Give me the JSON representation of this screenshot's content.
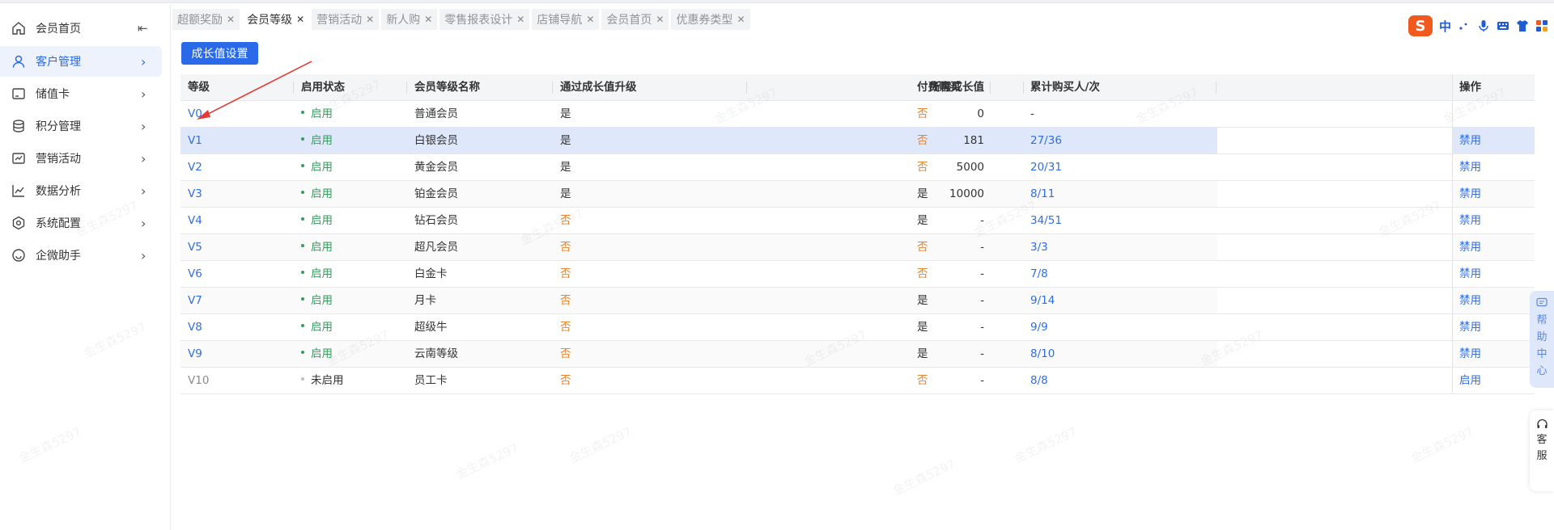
{
  "sidebar": {
    "collapse_icon": "collapse-left-icon",
    "items": [
      {
        "label": "会员首页",
        "icon": "home-icon",
        "has_chevron": false,
        "active": false
      },
      {
        "label": "客户管理",
        "icon": "user-icon",
        "has_chevron": true,
        "active": true
      },
      {
        "label": "储值卡",
        "icon": "card-icon",
        "has_chevron": true,
        "active": false
      },
      {
        "label": "积分管理",
        "icon": "database-icon",
        "has_chevron": true,
        "active": false
      },
      {
        "label": "营销活动",
        "icon": "chart-card-icon",
        "has_chevron": true,
        "active": false
      },
      {
        "label": "数据分析",
        "icon": "line-chart-icon",
        "has_chevron": true,
        "active": false
      },
      {
        "label": "系统配置",
        "icon": "settings-hex-icon",
        "has_chevron": true,
        "active": false
      },
      {
        "label": "企微助手",
        "icon": "chat-bubble-icon",
        "has_chevron": true,
        "active": false
      }
    ]
  },
  "tabs": [
    {
      "label": "超额奖励",
      "active": false
    },
    {
      "label": "会员等级",
      "active": true
    },
    {
      "label": "营销活动",
      "active": false
    },
    {
      "label": "新人购",
      "active": false
    },
    {
      "label": "零售报表设计",
      "active": false
    },
    {
      "label": "店铺导航",
      "active": false
    },
    {
      "label": "会员首页",
      "active": false
    },
    {
      "label": "优惠券类型",
      "active": false
    }
  ],
  "toolbar": {
    "growth_settings_label": "成长值设置"
  },
  "table": {
    "headers": {
      "level": "等级",
      "status": "启用状态",
      "name": "会员等级名称",
      "upgrade": "通过成长值升级",
      "required": "所需成长值",
      "paid": "付费购买",
      "buyers": "累计购买人/次",
      "ops": "操作"
    },
    "rows": [
      {
        "level": "V0",
        "status": "启用",
        "enabled": true,
        "name": "普通会员",
        "upgrade": "是",
        "required": "0",
        "paid": "否",
        "buyers": "-",
        "op": ""
      },
      {
        "level": "V1",
        "status": "启用",
        "enabled": true,
        "name": "白银会员",
        "upgrade": "是",
        "required": "181",
        "paid": "否",
        "buyers": "27/36",
        "op": "禁用"
      },
      {
        "level": "V2",
        "status": "启用",
        "enabled": true,
        "name": "黄金会员",
        "upgrade": "是",
        "required": "5000",
        "paid": "否",
        "buyers": "20/31",
        "op": "禁用"
      },
      {
        "level": "V3",
        "status": "启用",
        "enabled": true,
        "name": "铂金会员",
        "upgrade": "是",
        "required": "10000",
        "paid": "是",
        "buyers": "8/11",
        "op": "禁用"
      },
      {
        "level": "V4",
        "status": "启用",
        "enabled": true,
        "name": "钻石会员",
        "upgrade": "否",
        "required": "-",
        "paid": "是",
        "buyers": "34/51",
        "op": "禁用"
      },
      {
        "level": "V5",
        "status": "启用",
        "enabled": true,
        "name": "超凡会员",
        "upgrade": "否",
        "required": "-",
        "paid": "否",
        "buyers": "3/3",
        "op": "禁用"
      },
      {
        "level": "V6",
        "status": "启用",
        "enabled": true,
        "name": "白金卡",
        "upgrade": "否",
        "required": "-",
        "paid": "否",
        "buyers": "7/8",
        "op": "禁用"
      },
      {
        "level": "V7",
        "status": "启用",
        "enabled": true,
        "name": "月卡",
        "upgrade": "否",
        "required": "-",
        "paid": "是",
        "buyers": "9/14",
        "op": "禁用"
      },
      {
        "level": "V8",
        "status": "启用",
        "enabled": true,
        "name": "超级牛",
        "upgrade": "否",
        "required": "-",
        "paid": "是",
        "buyers": "9/9",
        "op": "禁用"
      },
      {
        "level": "V9",
        "status": "启用",
        "enabled": true,
        "name": "云南等级",
        "upgrade": "否",
        "required": "-",
        "paid": "是",
        "buyers": "8/10",
        "op": "禁用"
      },
      {
        "level": "V10",
        "status": "未启用",
        "enabled": false,
        "name": "员工卡",
        "upgrade": "否",
        "required": "-",
        "paid": "否",
        "buyers": "8/8",
        "op": "启用"
      }
    ]
  },
  "ime_toolbar": {
    "logo": "S",
    "mode": "中",
    "icons": [
      "punctuation-icon",
      "microphone-icon",
      "keyboard-icon",
      "shirt-icon",
      "grid-icon"
    ]
  },
  "help_float": {
    "chars": [
      "帮",
      "助",
      "中",
      "心"
    ],
    "icon": "help-chat-icon"
  },
  "service_float": {
    "chars": [
      "客",
      "服"
    ],
    "icon": "headset-icon"
  },
  "watermark": "金生森5297",
  "colors": {
    "accent": "#2a6ae9",
    "link": "#2f6ee6",
    "warn": "#e8842c",
    "enabled": "#3a9b5f",
    "annotation_arrow": "#e53935"
  }
}
